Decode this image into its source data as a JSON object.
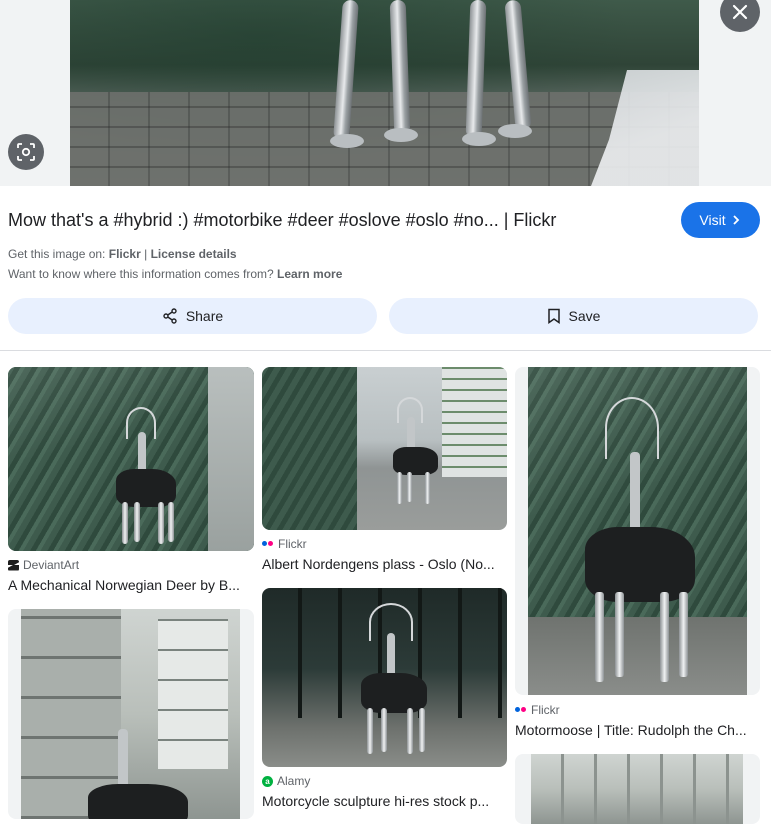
{
  "hero": {
    "close_label": "Close",
    "lens_label": "Search inside image"
  },
  "result": {
    "title": "Mow that's a #hybrid :) #motorbike #deer #oslove #oslo #no... | Flickr",
    "visit_label": "Visit",
    "get_image_prefix": "Get this image on:",
    "source": "Flickr",
    "separator": "|",
    "license_label": "License details",
    "info_question": "Want to know where this information comes from?",
    "learn_more": "Learn more",
    "share_label": "Share",
    "save_label": "Save"
  },
  "related": [
    {
      "source": "DeviantArt",
      "caption": "A Mechanical Norwegian Deer by B..."
    },
    {
      "source": "Flickr",
      "caption": "Albert Nordengens plass - Oslo (No..."
    },
    {
      "source": "Flickr",
      "caption": "Motormoose | Title: Rudolph the Ch..."
    },
    {
      "source": "Alamy",
      "caption": "Motorcycle sculpture hi-res stock p..."
    },
    {
      "source": "",
      "caption": ""
    },
    {
      "source": "",
      "caption": ""
    }
  ],
  "colors": {
    "accent": "#1a73e8",
    "tonal_button": "#e8f0fe",
    "overlay_button": "#5f6368",
    "flickr_blue": "#0063dc",
    "flickr_pink": "#ff0084",
    "alamy_green": "#00b140"
  },
  "icons": [
    "close-icon",
    "lens-icon",
    "chevron-right-icon",
    "share-icon",
    "bookmark-icon"
  ]
}
